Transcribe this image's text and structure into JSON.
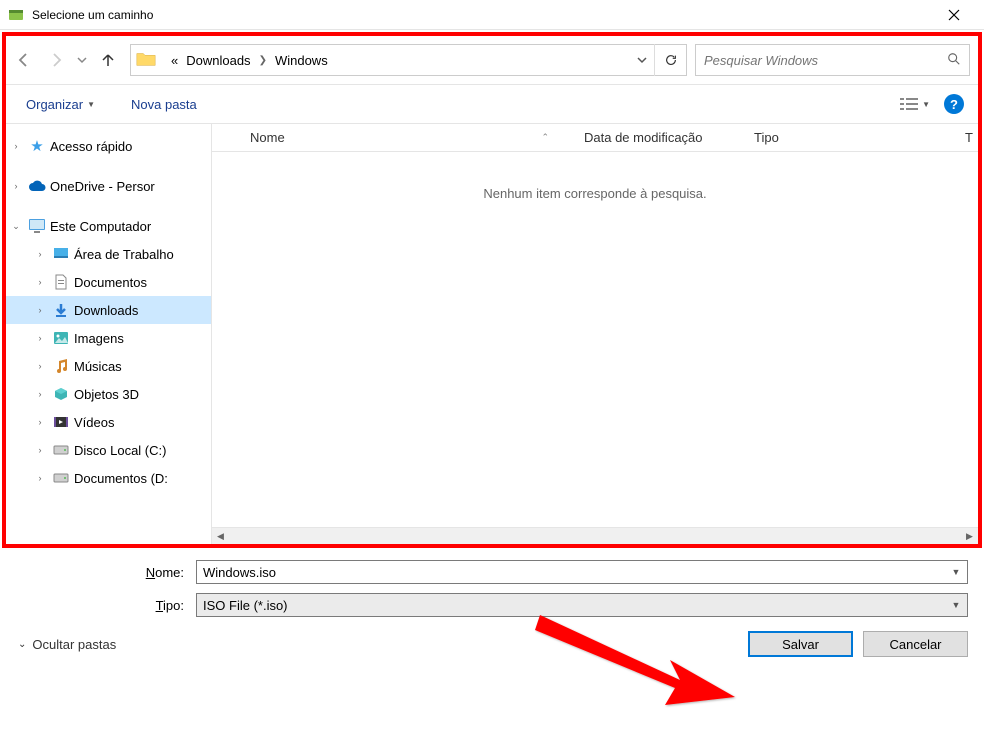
{
  "titlebar": {
    "title": "Selecione um caminho"
  },
  "breadcrumb": {
    "prefix": "«",
    "items": [
      "Downloads",
      "Windows"
    ]
  },
  "search": {
    "placeholder": "Pesquisar Windows"
  },
  "toolbar": {
    "organizar": "Organizar",
    "nova_pasta": "Nova pasta"
  },
  "columns": {
    "nome": "Nome",
    "data": "Data de modificação",
    "tipo": "Tipo",
    "extra": "T"
  },
  "empty_message": "Nenhum item corresponde à pesquisa.",
  "sidebar": {
    "items": [
      {
        "label": "Acesso rápido",
        "icon": "star",
        "level": 0,
        "chevron": "right"
      },
      {
        "label": "OneDrive - Persor",
        "icon": "cloud",
        "level": 0,
        "chevron": "right"
      },
      {
        "label": "Este Computador",
        "icon": "monitor",
        "level": 0,
        "chevron": "down"
      },
      {
        "label": "Área de Trabalho",
        "icon": "desktop",
        "level": 1,
        "chevron": "right"
      },
      {
        "label": "Documentos",
        "icon": "doc",
        "level": 1,
        "chevron": "right"
      },
      {
        "label": "Downloads",
        "icon": "download",
        "level": 1,
        "chevron": "right",
        "selected": true
      },
      {
        "label": "Imagens",
        "icon": "image",
        "level": 1,
        "chevron": "right"
      },
      {
        "label": "Músicas",
        "icon": "music",
        "level": 1,
        "chevron": "right"
      },
      {
        "label": "Objetos 3D",
        "icon": "3d",
        "level": 1,
        "chevron": "right"
      },
      {
        "label": "Vídeos",
        "icon": "video",
        "level": 1,
        "chevron": "right"
      },
      {
        "label": "Disco Local (C:)",
        "icon": "disk",
        "level": 1,
        "chevron": "right"
      },
      {
        "label": "Documentos (D:",
        "icon": "disk",
        "level": 1,
        "chevron": "right"
      }
    ]
  },
  "fields": {
    "nome_label": "Nome:",
    "nome_value": "Windows.iso",
    "tipo_label": "Tipo:",
    "tipo_value": "ISO File (*.iso)"
  },
  "buttons": {
    "hide_folders": "Ocultar pastas",
    "save": "Salvar",
    "cancel": "Cancelar"
  }
}
